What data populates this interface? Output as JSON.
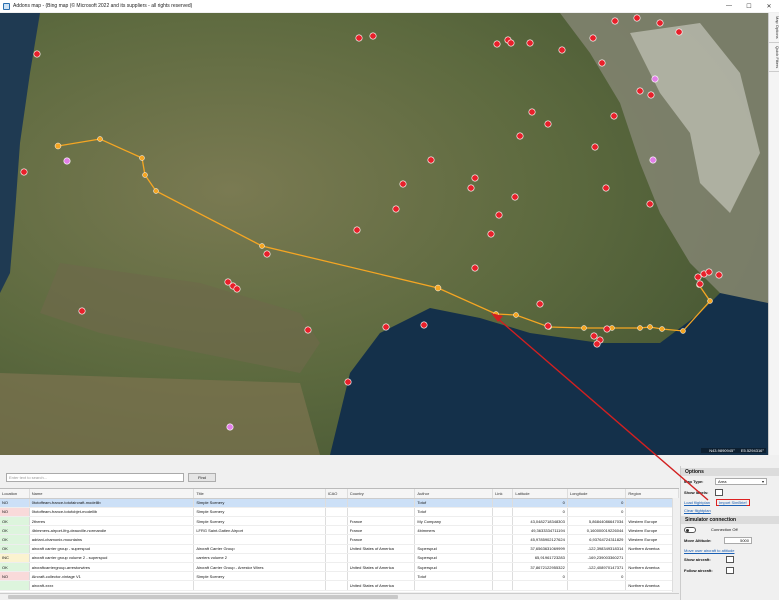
{
  "window": {
    "title": "Addons map - (Bing map (© Microsoft 2022 and its suppliers - all rights reserved)",
    "minimize": "—",
    "maximize": "☐",
    "close": "✕"
  },
  "side_tabs": [
    "Map Options",
    "Quick Filters"
  ],
  "map": {
    "coord_lat": "N43.9890945°",
    "coord_lon": "E5.5294316°"
  },
  "search": {
    "placeholder": "Enter text to search...",
    "find_label": "Find"
  },
  "table": {
    "columns": [
      "Location",
      "Name",
      "Title",
      "ICAO",
      "Country",
      "Author",
      "Link",
      "Latitude",
      "Longitude",
      "Region"
    ],
    "rows": [
      {
        "location": "NO",
        "name": "0totoffeam-france-totofaircraft-modellib",
        "title": "Simple Scenery",
        "icao": "",
        "country": "",
        "author": "Totof",
        "link": "",
        "lat": "0",
        "lon": "0",
        "region": "",
        "status": "no",
        "selected": true
      },
      {
        "location": "NO",
        "name": "0totoffeam-france-totofobjet-modellib",
        "title": "Simple Scenery",
        "icao": "",
        "country": "",
        "author": "Totof",
        "link": "",
        "lat": "0",
        "lon": "0",
        "region": "",
        "status": "no",
        "selected": false
      },
      {
        "location": "OK",
        "name": "2theres",
        "title": "Simple Scenery",
        "icao": "",
        "country": "France",
        "author": "My Company",
        "link": "",
        "lat": "43,0482718348303",
        "lon": "5,86844086647034",
        "region": "Western Europe",
        "status": "ok",
        "selected": false
      },
      {
        "location": "OK",
        "name": "4bimmers-airport-lfrg-deauville-normandie",
        "title": "LFRG Saint-Gatien Airport",
        "icao": "",
        "country": "France",
        "author": "4bimmers",
        "link": "",
        "lat": "49,3633334711194",
        "lon": "0,160000019226044",
        "region": "Western Europe",
        "status": "ok",
        "selected": false
      },
      {
        "location": "OK",
        "name": "adriani-chamonix-mountains",
        "title": "",
        "icao": "",
        "country": "France",
        "author": "",
        "link": "",
        "lat": "45,9785902127624",
        "lon": "6,93764724311829",
        "region": "Western Europe",
        "status": "ok",
        "selected": false
      },
      {
        "location": "OK",
        "name": "aircraft carrier group - superspud",
        "title": "Aircraft Carrier Group",
        "icao": "",
        "country": "United States of America",
        "author": "Superspud",
        "link": "",
        "lat": "37,6563631069999",
        "lon": "-122,398349318314",
        "region": "Northern America",
        "status": "ok",
        "selected": false
      },
      {
        "location": "INC",
        "name": "aircraft carrier group volume 2 - superspud",
        "title": "carriers volume 2",
        "icao": "",
        "country": "",
        "author": "Superspud",
        "link": "",
        "lat": "65,91961723283",
        "lon": "-169,239003360271",
        "region": "",
        "status": "inc",
        "selected": false
      },
      {
        "location": "OK",
        "name": "aircraftcarriergroup-arrestorwires",
        "title": "Aircraft Carrier Group - Arrestor Wires",
        "icao": "",
        "country": "United States of America",
        "author": "Superspud",
        "link": "",
        "lat": "37,8672122955322",
        "lon": "-122,408970147371",
        "region": "Northern America",
        "status": "ok",
        "selected": false
      },
      {
        "location": "NO",
        "name": "Aircraft-collector-vintage V1",
        "title": "Simple Scenery",
        "icao": "",
        "country": "",
        "author": "Totof",
        "link": "",
        "lat": "0",
        "lon": "0",
        "region": "",
        "status": "no",
        "selected": false
      },
      {
        "location": "",
        "name": "aircraft-xxxx",
        "title": "",
        "icao": "",
        "country": "United States of America",
        "author": "",
        "link": "",
        "lat": "",
        "lon": "",
        "region": "Northern America",
        "status": "ok",
        "selected": false
      }
    ]
  },
  "options": {
    "header": "Options",
    "map_type_label": "Map Type:",
    "map_type_value": "Area",
    "show_labels_label": "Show labels:",
    "load_flightplan": "Load flightplan",
    "import_simbrief": "Import SimBrief",
    "clear_flightplan": "Clear flightplan"
  },
  "simulator": {
    "header": "Simulator connection",
    "connection_status": "Connection Off",
    "move_altitude_label": "Move Altitude:",
    "move_altitude_value": "5000",
    "move_user_aircraft": "Move user aircraft to altitude",
    "show_aircraft_label": "Show aircraft:",
    "follow_aircraft_label": "Follow aircraft:"
  },
  "colors": {
    "route": "#f5a623",
    "poi": "#e8202a",
    "poi_alt": "#e27fe8",
    "arrow": "#d22020"
  }
}
